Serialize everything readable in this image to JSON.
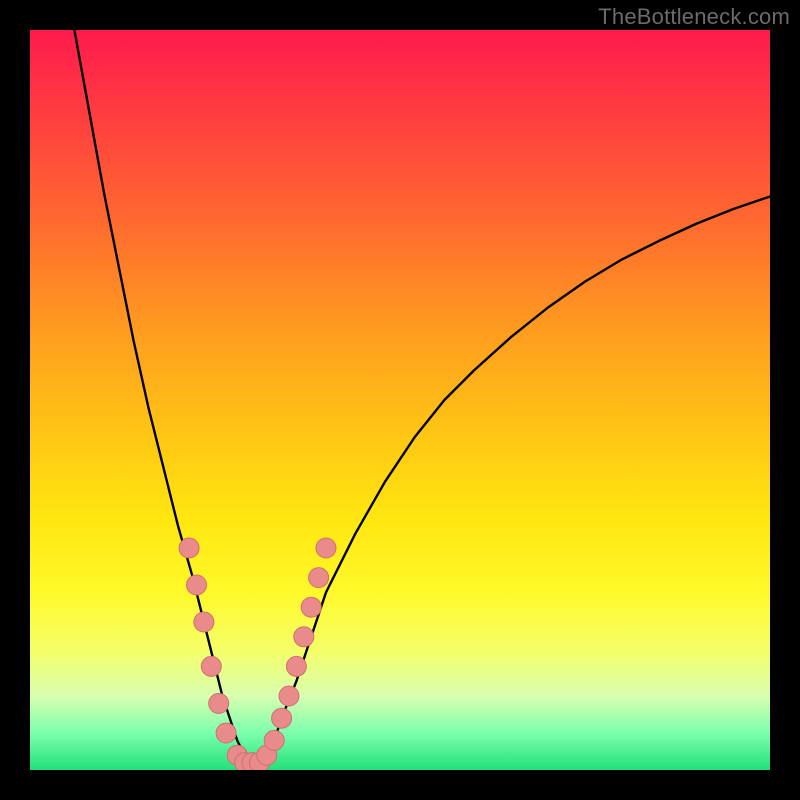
{
  "watermark": "TheBottleneck.com",
  "colors": {
    "background": "#000000",
    "curve_stroke": "#000000",
    "marker_fill": "#e98b8b",
    "marker_stroke": "#d06f6f",
    "gradient_stops": [
      "#ff1a4d",
      "#ff3f3f",
      "#ff6a2f",
      "#ff9a20",
      "#ffc414",
      "#ffe610",
      "#fff92a",
      "#f4ff6a",
      "#d8ffb0",
      "#7cffad",
      "#22e07a"
    ]
  },
  "chart_data": {
    "type": "line",
    "title": "",
    "xlabel": "",
    "ylabel": "",
    "xlim": [
      0,
      100
    ],
    "ylim": [
      0,
      100
    ],
    "grid": false,
    "legend": false,
    "series": [
      {
        "name": "curve",
        "x": [
          6,
          8,
          10,
          12,
          14,
          16,
          18,
          20,
          22,
          23,
          24,
          25,
          26,
          27,
          28,
          29,
          30,
          31,
          32,
          33,
          34,
          36,
          38,
          40,
          44,
          48,
          52,
          56,
          60,
          65,
          70,
          75,
          80,
          85,
          90,
          95,
          100
        ],
        "y": [
          100,
          89,
          78,
          68,
          58,
          49,
          41,
          33,
          26,
          22,
          18,
          14,
          10,
          7,
          4,
          2,
          1,
          1,
          2,
          4,
          7,
          12,
          18,
          24,
          32,
          39,
          45,
          50,
          54,
          58.5,
          62.5,
          66,
          69,
          71.5,
          73.8,
          75.8,
          77.5
        ]
      }
    ],
    "markers": [
      {
        "x": 21.5,
        "y": 30
      },
      {
        "x": 22.5,
        "y": 25
      },
      {
        "x": 23.5,
        "y": 20
      },
      {
        "x": 24.5,
        "y": 14
      },
      {
        "x": 25.5,
        "y": 9
      },
      {
        "x": 26.5,
        "y": 5
      },
      {
        "x": 28,
        "y": 2
      },
      {
        "x": 29,
        "y": 1
      },
      {
        "x": 30,
        "y": 1
      },
      {
        "x": 31,
        "y": 1
      },
      {
        "x": 32,
        "y": 2
      },
      {
        "x": 33,
        "y": 4
      },
      {
        "x": 34,
        "y": 7
      },
      {
        "x": 35,
        "y": 10
      },
      {
        "x": 36,
        "y": 14
      },
      {
        "x": 37,
        "y": 18
      },
      {
        "x": 38,
        "y": 22
      },
      {
        "x": 39,
        "y": 26
      },
      {
        "x": 40,
        "y": 30
      }
    ]
  }
}
